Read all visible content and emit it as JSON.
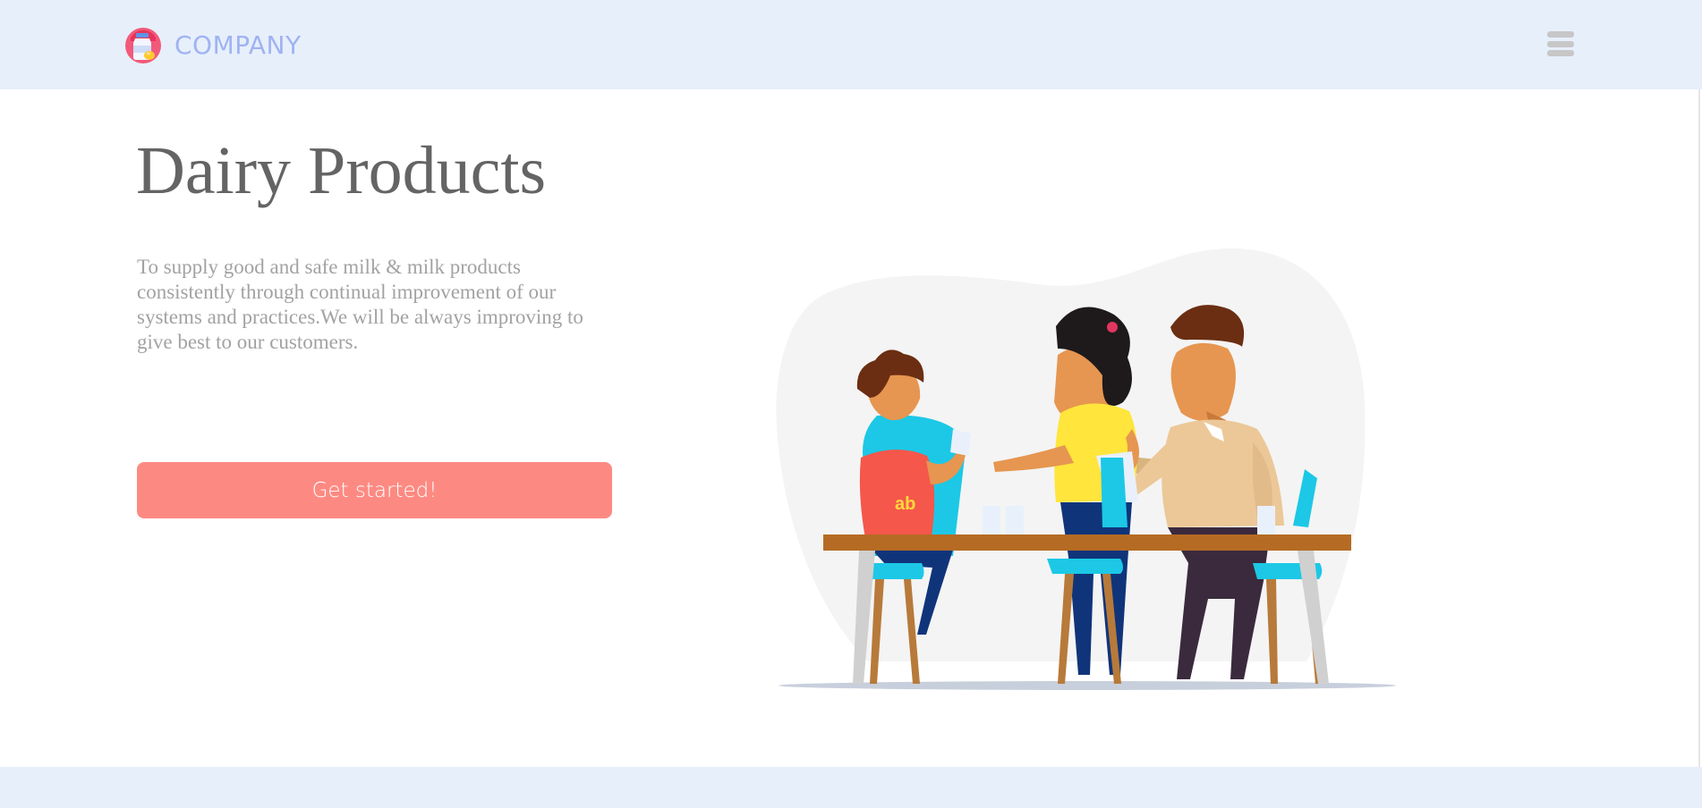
{
  "header": {
    "brand_name": "COMPANY",
    "logo_icon": "milk-bottle-logo-icon",
    "menu_icon": "hamburger-menu-icon"
  },
  "hero": {
    "title": "Dairy Products",
    "description": "To supply good and safe milk & milk products consistently through continual improvement of our systems and practices.We will be always improving to give best to our customers.",
    "cta_label": "Get started!",
    "illustration": "family-at-table-illustration"
  },
  "colors": {
    "header_background": "#e7effb",
    "brand_text": "#9fb3f2",
    "title_text": "#646464",
    "body_text": "#a2a2a2",
    "cta_background": "#fd8a82",
    "cta_text": "#ffffff",
    "footer_background": "#e7effb"
  }
}
